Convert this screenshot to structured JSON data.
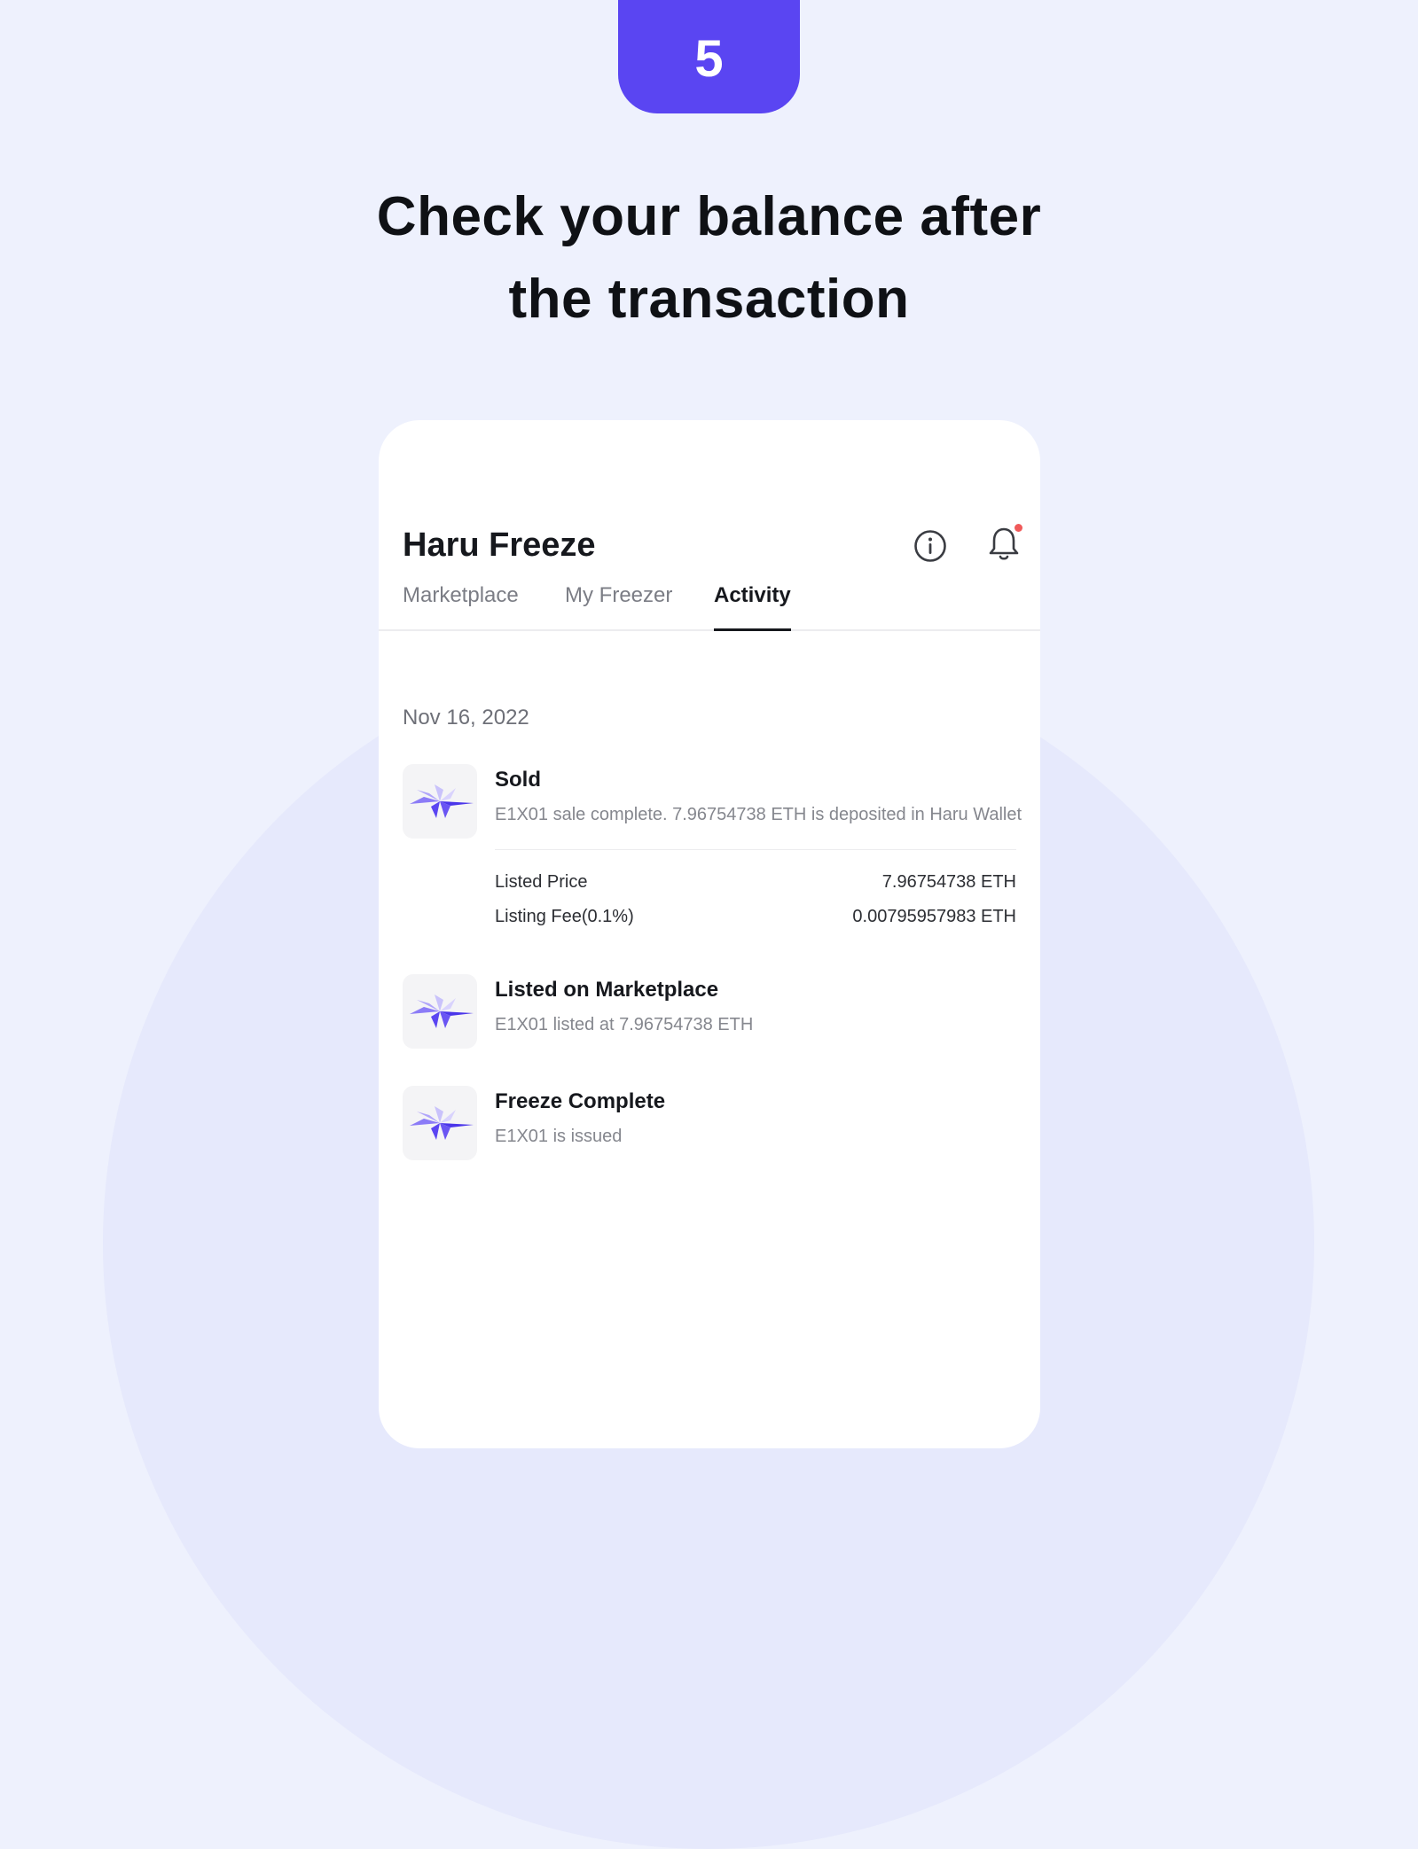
{
  "step": "5",
  "headline": {
    "line1": "Check your balance after",
    "line2": "the transaction"
  },
  "app": {
    "title": "Haru Freeze",
    "header_icons": [
      "info-icon",
      "bell-icon"
    ],
    "has_notification": true,
    "tabs": [
      {
        "label": "Marketplace",
        "active": false
      },
      {
        "label": "My Freezer",
        "active": false
      },
      {
        "label": "Activity",
        "active": true
      }
    ]
  },
  "activity": {
    "date": "Nov 16, 2022",
    "items": [
      {
        "title": "Sold",
        "description": "E1X01 sale complete. 7.96754738 ETH is deposited in Haru Wallet",
        "details": [
          {
            "label": "Listed Price",
            "value": "7.96754738 ETH"
          },
          {
            "label": "Listing Fee(0.1%)",
            "value": "0.00795957983 ETH"
          }
        ]
      },
      {
        "title": "Listed on Marketplace",
        "description": "E1X01 listed at 7.96754738 ETH"
      },
      {
        "title": "Freeze Complete",
        "description": "E1X01 is issued"
      }
    ]
  },
  "colors": {
    "accent": "#5a45f2",
    "background": "#eef1fd",
    "notification_dot": "#f05a5a"
  }
}
